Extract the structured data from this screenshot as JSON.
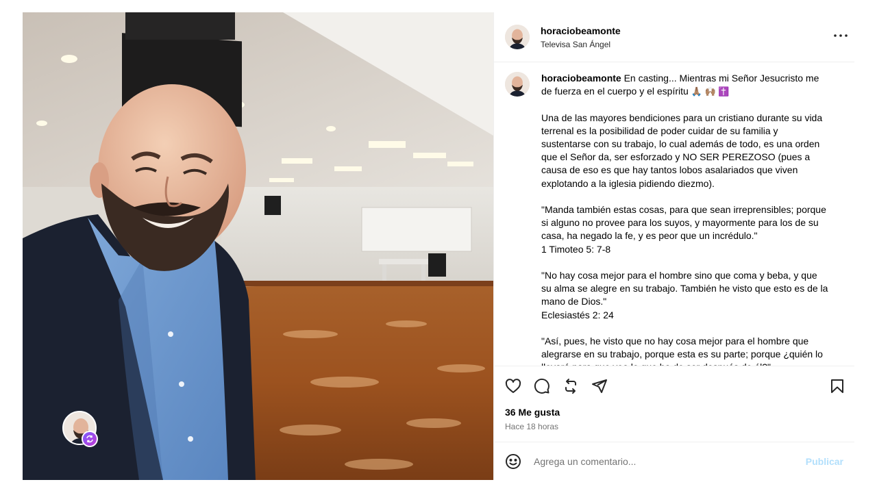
{
  "post": {
    "username": "horaciobeamonte",
    "location": "Televisa San Ángel"
  },
  "caption": {
    "username": "horaciobeamonte",
    "first_line": " En casting... Mientras mi Señor Jesucristo me de fuerza en el cuerpo y el espíritu",
    "emojis": "🙏🏽 🙌🏽 ✝️",
    "paragraphs": [
      "Una de las mayores bendiciones para un cristiano durante su vida terrenal es la posibilidad de poder cuidar de su familia y sustentarse con su trabajo, lo cual además de todo, es una orden que el Señor da, ser esforzado y NO SER PEREZOSO (pues a causa de eso es que hay tantos lobos asalariados que viven explotando a la iglesia pidiendo diezmo).",
      "\"Manda también estas cosas, para que sean irreprensibles; porque si alguno no provee para los suyos, y mayormente para los de su casa, ha negado la fe, y es peor que un incrédulo.\"",
      "1 Timoteo 5: 7-8",
      "\"No hay cosa mejor para el hombre sino que coma y beba, y que su alma se alegre en su trabajo. También he visto que esto es de la mano de Dios.\"",
      "Eclesiastés 2: 24",
      "\"Así, pues, he visto que no hay cosa mejor para el hombre que alegrarse en su trabajo, porque esta es su parte; porque ¿quién lo llevará para que vea lo que ha de ser después de él?\""
    ]
  },
  "stats": {
    "likes": "36 Me gusta",
    "time": "Hace 18 horas"
  },
  "comment": {
    "placeholder": "Agrega un comentario...",
    "publish_label": "Publicar"
  },
  "icons": {
    "more": "more-options-icon",
    "like": "heart-icon",
    "comment": "comment-icon",
    "repost": "repost-icon",
    "share": "share-icon",
    "save": "bookmark-icon",
    "emoji": "emoji-icon"
  },
  "colors": {
    "accent_disabled": "#b2dffc",
    "secondary_text": "#737373",
    "divider": "#efefef"
  }
}
